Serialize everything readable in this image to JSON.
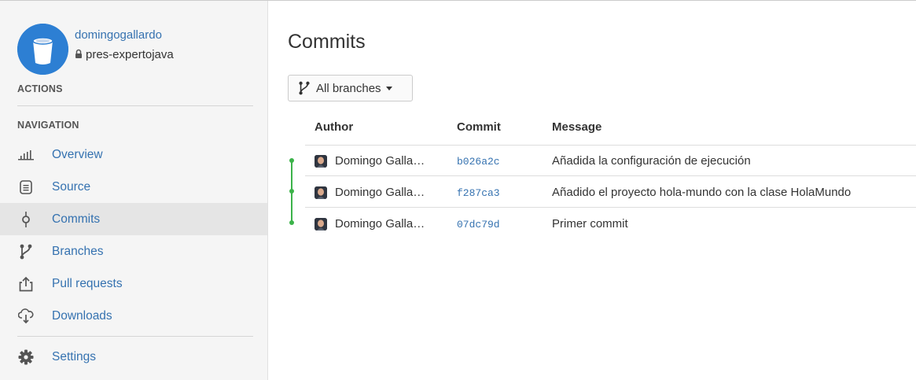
{
  "repo": {
    "owner": "domingogallardo",
    "name": "pres-expertojava"
  },
  "sidebar": {
    "actions_heading": "ACTIONS",
    "navigation_heading": "NAVIGATION",
    "items": [
      {
        "label": "Overview",
        "icon": "overview-icon"
      },
      {
        "label": "Source",
        "icon": "source-icon"
      },
      {
        "label": "Commits",
        "icon": "commits-icon",
        "active": true
      },
      {
        "label": "Branches",
        "icon": "branches-icon"
      },
      {
        "label": "Pull requests",
        "icon": "pull-requests-icon"
      },
      {
        "label": "Downloads",
        "icon": "downloads-icon"
      }
    ],
    "settings": {
      "label": "Settings",
      "icon": "settings-icon"
    }
  },
  "main": {
    "title": "Commits",
    "branch_filter": "All branches",
    "columns": {
      "author": "Author",
      "commit": "Commit",
      "message": "Message"
    },
    "commits": [
      {
        "author": "Domingo Galla…",
        "hash": "b026a2c",
        "message": "Añadida la configuración de ejecución"
      },
      {
        "author": "Domingo Galla…",
        "hash": "f287ca3",
        "message": "Añadido el proyecto hola-mundo con la clase HolaMundo"
      },
      {
        "author": "Domingo Galla…",
        "hash": "07dc79d",
        "message": "Primer commit"
      }
    ]
  },
  "colors": {
    "link": "#3572b0",
    "graph": "#3cb34a",
    "avatar": "#2d7fd3"
  }
}
